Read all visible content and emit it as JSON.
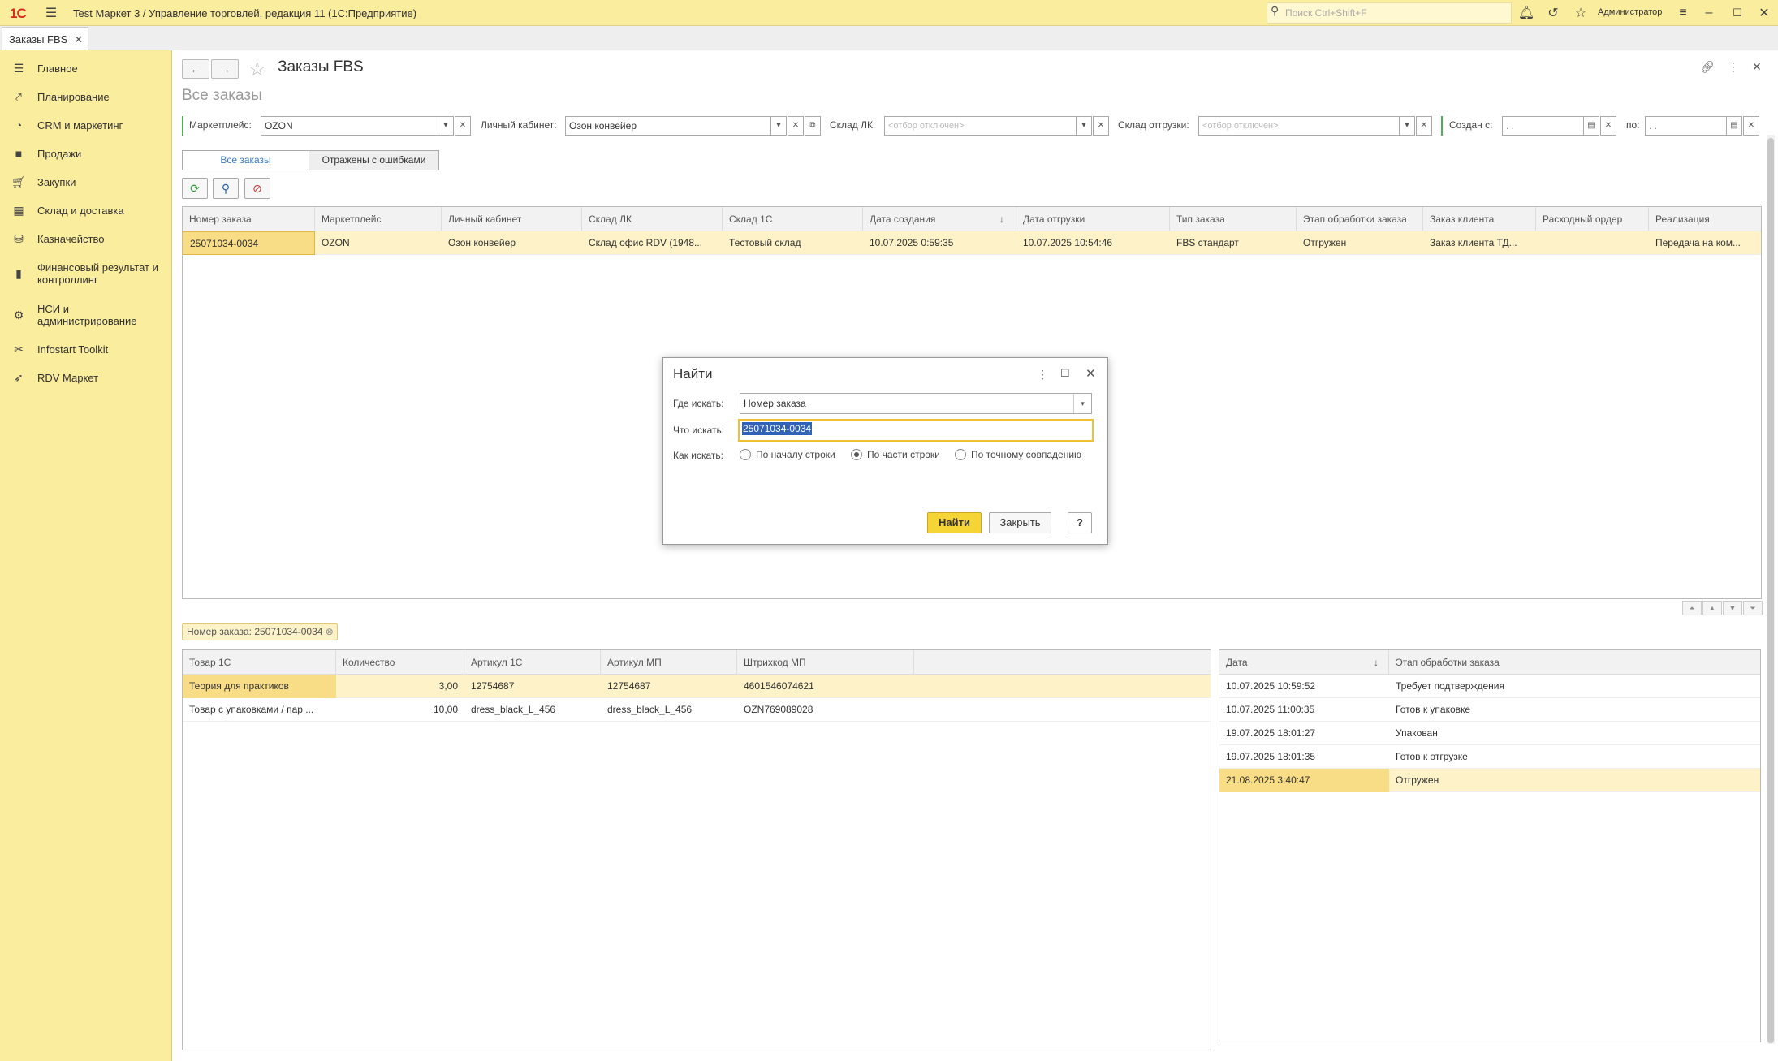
{
  "app": {
    "logo": "1С",
    "title": "Test Маркет 3 / Управление торговлей, редакция 11  (1С:Предприятие)",
    "search_placeholder": "Поиск Ctrl+Shift+F",
    "user": "Администратор"
  },
  "tabs": [
    {
      "label": "Заказы FBS"
    }
  ],
  "sidebar": {
    "items": [
      {
        "label": "Главное",
        "icon": "menu-icon"
      },
      {
        "label": "Планирование",
        "icon": "planning-icon"
      },
      {
        "label": "CRM и маркетинг",
        "icon": "crm-icon"
      },
      {
        "label": "Продажи",
        "icon": "sales-icon"
      },
      {
        "label": "Закупки",
        "icon": "cart-icon"
      },
      {
        "label": "Склад и доставка",
        "icon": "warehouse-icon"
      },
      {
        "label": "Казначейство",
        "icon": "treasury-icon"
      },
      {
        "label": "Финансовый результат и",
        "label2": "контроллинг",
        "icon": "chart-icon"
      },
      {
        "label": "НСИ и",
        "label2": "администрирование",
        "icon": "gear-icon"
      },
      {
        "label": "Infostart Toolkit",
        "icon": "tools-icon"
      },
      {
        "label": "RDV Маркет",
        "icon": "rocket-icon"
      }
    ]
  },
  "page": {
    "title": "Заказы FBS",
    "subtitle": "Все заказы"
  },
  "filters": {
    "marketplace_label": "Маркетплейс:",
    "marketplace_value": "OZON",
    "cabinet_label": "Личный кабинет:",
    "cabinet_value": "Озон конвейер",
    "warehouse_label": "Склад ЛК:",
    "warehouse_placeholder": "<отбор отключен>",
    "ship_label": "Склад отгрузки:",
    "ship_placeholder": "<отбор отключен>",
    "created_label": "Создан с:",
    "created_from": " .  .",
    "to_label": "по:",
    "created_to": " .  ."
  },
  "switch": {
    "all": "Все заказы",
    "errors": "Отражены с ошибками"
  },
  "orders": {
    "columns": [
      "Номер заказа",
      "Маркетплейс",
      "Личный кабинет",
      "Склад ЛК",
      "Склад 1С",
      "Дата создания",
      "Дата отгрузки",
      "Тип заказа",
      "Этап обработки заказа",
      "Заказ клиента",
      "Расходный ордер",
      "Реализация"
    ],
    "rows": [
      [
        "25071034-0034",
        "OZON",
        "Озон конвейер",
        "Склад офис RDV (1948...",
        "Тестовый склад",
        "10.07.2025 0:59:35",
        "10.07.2025 10:54:46",
        "FBS стандарт",
        "Отгружен",
        "Заказ клиента ТД...",
        "",
        "Передача на ком..."
      ]
    ]
  },
  "dialog": {
    "title": "Найти",
    "where_label": "Где искать:",
    "where_value": "Номер заказа",
    "what_label": "Что искать:",
    "what_value": "25071034-0034",
    "how_label": "Как искать:",
    "opt1": "По началу строки",
    "opt2": "По части строки",
    "opt3": "По точному совпадению",
    "find": "Найти",
    "close": "Закрыть",
    "help": "?"
  },
  "chip": "Номер заказа: 25071034-0034",
  "goods": {
    "columns": [
      "Товар 1С",
      "Количество",
      "Артикул 1С",
      "Артикул МП",
      "Штрихкод МП"
    ],
    "rows": [
      [
        "Теория для практиков",
        "3,00",
        "12754687",
        "12754687",
        "4601546074621"
      ],
      [
        "Товар с упаковками / пар ...",
        "10,00",
        "dress_black_L_456",
        "dress_black_L_456",
        "OZN769089028"
      ]
    ]
  },
  "stages": {
    "columns": [
      "Дата",
      "Этап обработки заказа"
    ],
    "rows": [
      [
        "10.07.2025 10:59:52",
        "Требует подтверждения"
      ],
      [
        "10.07.2025 11:00:35",
        "Готов к упаковке"
      ],
      [
        "19.07.2025 18:01:27",
        "Упакован"
      ],
      [
        "19.07.2025 18:01:35",
        "Готов к отгрузке"
      ],
      [
        "21.08.2025 3:40:47",
        "Отгружен"
      ]
    ]
  }
}
